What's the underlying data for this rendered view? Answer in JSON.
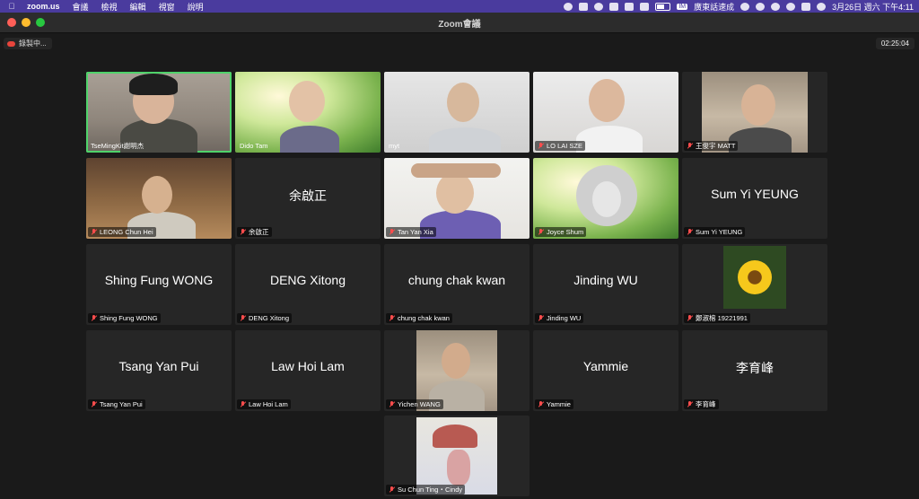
{
  "menubar": {
    "app": "zoom.us",
    "items": [
      "會議",
      "檢視",
      "編輯",
      "視窗",
      "說明"
    ],
    "ime": "廣東話速成",
    "clock": "3月26日 週六 下午4:11"
  },
  "window": {
    "title": "Zoom會議"
  },
  "recording": {
    "label": "錄製中..."
  },
  "timer": {
    "value": "02:25:04"
  },
  "participants": [
    {
      "name": "TseMingKit謝明杰",
      "muted": false,
      "video": true
    },
    {
      "name": "Dido Tam",
      "muted": false,
      "video": true
    },
    {
      "name": "myt",
      "muted": false,
      "video": true
    },
    {
      "name": "LO LAI SZE",
      "muted": true,
      "video": true
    },
    {
      "name": "王俊宇 MATT",
      "muted": true,
      "video": true
    },
    {
      "name": "LEONG Chun Hei",
      "muted": true,
      "video": true
    },
    {
      "name": "余啟正",
      "muted": true,
      "video": false
    },
    {
      "name": "Tan Yan Xia",
      "muted": true,
      "video": true
    },
    {
      "name": "Joyce Shum",
      "muted": true,
      "video": true
    },
    {
      "name": "Sum Yi YEUNG",
      "muted": true,
      "video": false
    },
    {
      "name": "Shing Fung WONG",
      "muted": true,
      "video": false
    },
    {
      "name": "DENG Xitong",
      "muted": true,
      "video": false
    },
    {
      "name": "chung chak kwan",
      "muted": true,
      "video": false
    },
    {
      "name": "Jinding WU",
      "muted": true,
      "video": false
    },
    {
      "name": "鄭淑榕 19221991",
      "muted": true,
      "video": true
    },
    {
      "name": "Tsang Yan Pui",
      "muted": true,
      "video": false
    },
    {
      "name": "Law Hoi Lam",
      "muted": true,
      "video": false
    },
    {
      "name": "Yichen WANG",
      "muted": true,
      "video": true
    },
    {
      "name": "Yammie",
      "muted": true,
      "video": false
    },
    {
      "name": "李育峰",
      "muted": true,
      "video": false
    },
    {
      "name": "Su Chun Ting・Cindy",
      "muted": true,
      "video": true
    }
  ]
}
